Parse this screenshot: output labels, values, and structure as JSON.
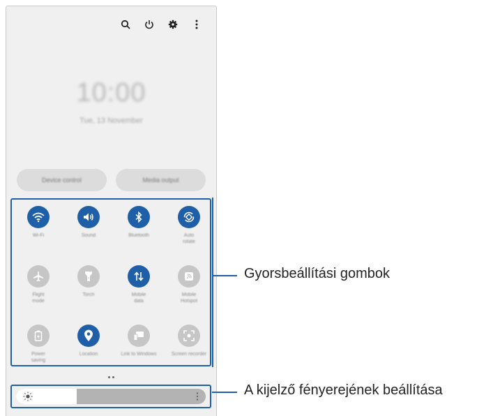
{
  "top_icons": [
    "search-icon",
    "power-icon",
    "settings-icon",
    "more-icon"
  ],
  "clock": {
    "time": "10:00",
    "date": "Tue, 13 November"
  },
  "buttons": {
    "device_control": "Device control",
    "media_output": "Media output"
  },
  "quick_settings": [
    {
      "label": "Wi-Fi",
      "icon": "wifi-icon",
      "active": true
    },
    {
      "label": "Sound",
      "icon": "sound-icon",
      "active": true
    },
    {
      "label": "Bluetooth",
      "icon": "bluetooth-icon",
      "active": true
    },
    {
      "label": "Auto\nrotate",
      "icon": "auto-rotate-icon",
      "active": true
    },
    {
      "label": "Flight\nmode",
      "icon": "airplane-icon",
      "active": false
    },
    {
      "label": "Torch",
      "icon": "torch-icon",
      "active": false
    },
    {
      "label": "Mobile\ndata",
      "icon": "mobile-data-icon",
      "active": true
    },
    {
      "label": "Mobile\nHotspot",
      "icon": "hotspot-icon",
      "active": false
    },
    {
      "label": "Power\nsaving",
      "icon": "power-saving-icon",
      "active": false
    },
    {
      "label": "Location",
      "icon": "location-icon",
      "active": true
    },
    {
      "label": "Link to Windows",
      "icon": "link-windows-icon",
      "active": false
    },
    {
      "label": "Screen recorder",
      "icon": "screen-recorder-icon",
      "active": false
    }
  ],
  "brightness": {
    "level": 0.32
  },
  "annotations": {
    "quick_buttons": "Gyorsbeállítási gombok",
    "brightness": "A kijelző fényerejének beállítása"
  },
  "colors": {
    "accent": "#1f5fa8",
    "inactive": "#c6c6c6",
    "background": "#f0f0f0"
  }
}
